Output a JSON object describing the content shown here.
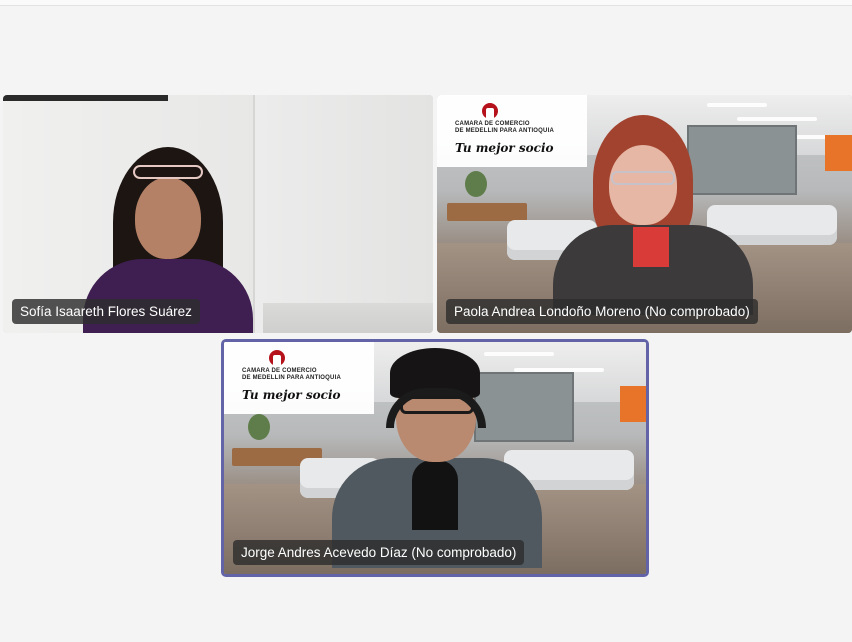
{
  "meeting": {
    "participants": [
      {
        "name": "Sofía Isaareth Flores Suárez",
        "background": "white-wall"
      },
      {
        "name": "Paola Andrea Londoño Moreno (No comprobado)",
        "background": "office",
        "brand": {
          "org": "CAMARA DE COMERCIO\nDE MEDELLIN PARA ANTIOQUIA",
          "slogan": "Tu mejor socio"
        }
      },
      {
        "name": "Jorge Andres Acevedo Díaz (No comprobado)",
        "background": "office",
        "active_speaker": true,
        "brand": {
          "org": "CAMARA DE COMERCIO\nDE MEDELLIN PARA ANTIOQUIA",
          "slogan": "Tu mejor socio"
        }
      }
    ]
  },
  "colors": {
    "active_speaker_border": "#6264a7",
    "label_bg": "rgba(45,45,45,0.82)",
    "brand_red": "#b5121b"
  }
}
